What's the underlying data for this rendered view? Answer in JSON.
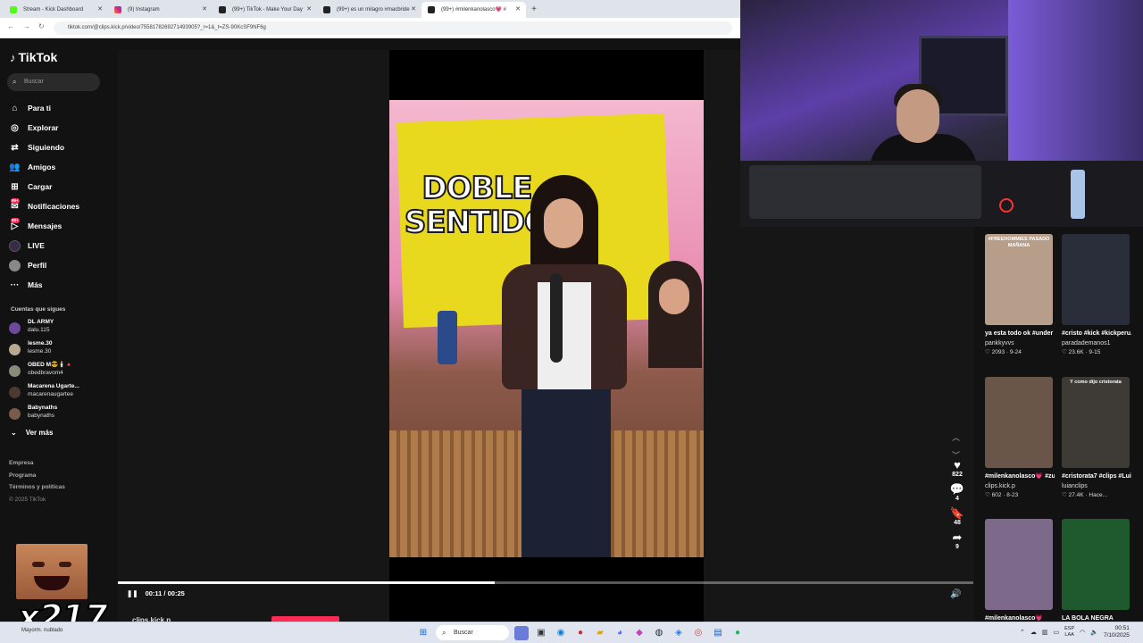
{
  "browser": {
    "tabs": [
      {
        "title": "Stream - Kick Dashboard",
        "icon": "kick-icon"
      },
      {
        "title": "(9) Instagram",
        "icon": "instagram-icon"
      },
      {
        "title": "(99+) TikTok - Make Your Day",
        "icon": "tiktok-icon"
      },
      {
        "title": "(99+) es un milagro #macbride",
        "icon": "tiktok-icon"
      },
      {
        "title": "(99+) #milenkanolasco💗 #",
        "icon": "tiktok-icon"
      }
    ],
    "new_tab": "+",
    "url": "tiktok.com/@clips.kick.p/video/7558178269271493905?_r=1&_t=ZS-90KcSF9NF6g"
  },
  "tiktok": {
    "logo": "TikTok",
    "search_placeholder": "Buscar",
    "menu": [
      {
        "label": "Para ti",
        "icon": "home-icon"
      },
      {
        "label": "Explorar",
        "icon": "compass-icon"
      },
      {
        "label": "Siguiendo",
        "icon": "following-icon"
      },
      {
        "label": "Amigos",
        "icon": "friends-icon"
      },
      {
        "label": "Cargar",
        "icon": "upload-icon"
      },
      {
        "label": "Notificaciones",
        "icon": "bell-icon",
        "badge": "99+"
      },
      {
        "label": "Mensajes",
        "icon": "message-icon",
        "badge": "99+"
      },
      {
        "label": "LIVE",
        "icon": "live-icon"
      },
      {
        "label": "Perfil",
        "icon": "profile-icon"
      },
      {
        "label": "Más",
        "icon": "more-icon"
      }
    ],
    "following_title": "Cuentas que sigues",
    "following": [
      {
        "name": "DL ARMY",
        "handle": "dalu.115"
      },
      {
        "name": "lesme.30",
        "handle": "lesme.30"
      },
      {
        "name": "OBED M😎🕯️🔺",
        "handle": "obedbravom4"
      },
      {
        "name": "Macarena Ugarte...",
        "handle": "macarenaugartee"
      },
      {
        "name": "Babynaths",
        "handle": "babynaths"
      }
    ],
    "ver_mas": "Ver más",
    "footer": [
      "Empresa",
      "Programa",
      "Términos y políticas",
      "© 2025 TikTok"
    ],
    "video": {
      "overlay_title": "DOBLE SENTIDO",
      "time": "00:11 / 00:25",
      "progress_fraction": 0.44,
      "author": "clips.kick.p",
      "likes": "822",
      "comments": "4",
      "saves": "48",
      "shares": "9"
    },
    "recommendations": [
      {
        "caption": "#FREEHOMMIES PASADO MAÑANA",
        "title": "ya esta todo ok #under #fyp...",
        "user": "pankkyvvs",
        "stats": "♡ 2093 · 9-24",
        "color": "#b79e8a"
      },
      {
        "caption": "",
        "title": "#cristo #kick #kickperu...",
        "user": "paradademanos1",
        "stats": "♡ 23.6K · 9-15",
        "color": "#2a2e3a"
      },
      {
        "caption": "",
        "title": "#milenkanolasco💗 #zumba #videovira...",
        "user": "clips.kick.p",
        "stats": "♡ 602 · 8-23",
        "color": "#6a5648"
      },
      {
        "caption": "Y como dijo cristorata",
        "title": "#cristorata7 #clips #LuianClips",
        "user": "luianclips",
        "stats": "♡ 27.4K · Hace...",
        "color": "#3e3a36"
      },
      {
        "caption": "",
        "title": "#milenkanolasco💗",
        "user": "",
        "stats": "",
        "color": "#7d6a8a"
      },
      {
        "caption": "",
        "title": "LA BOLA NEGRA",
        "user": "",
        "stats": "",
        "color": "#1f5a2e"
      }
    ]
  },
  "overlay": {
    "multiplier": "x217"
  },
  "taskbar": {
    "weather": "Mayorm. nublado",
    "search": "Buscar",
    "lang": "ESP\nLAA",
    "time": "00:51",
    "date": "7/10/2025"
  }
}
